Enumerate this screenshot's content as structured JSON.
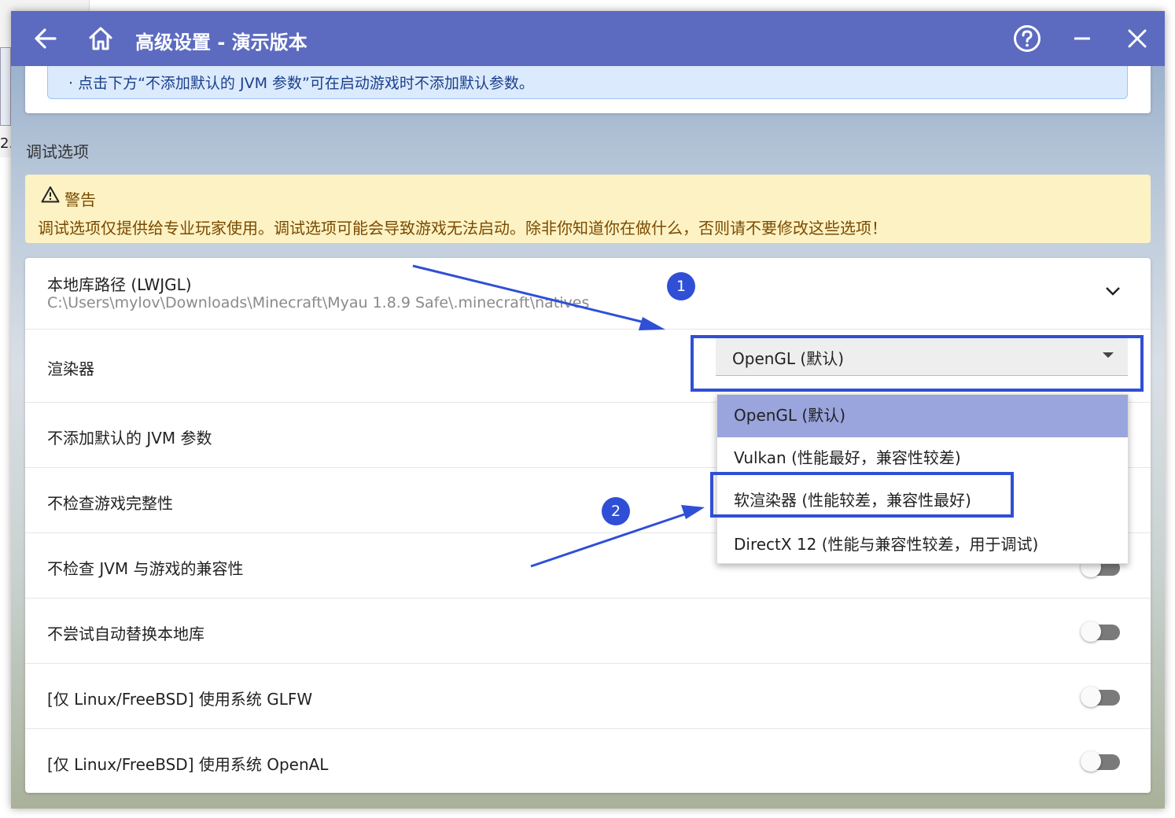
{
  "window": {
    "title": "高级设置 - 演示版本"
  },
  "background_window": {
    "fragment_text": "2."
  },
  "info_box": {
    "text": "· 点击下方“不添加默认的 JVM 参数”可在启动游戏时不添加默认参数。"
  },
  "debug_section": {
    "title": "调试选项",
    "warning_title": "警告",
    "warning_text": "调试选项仅提供给专业玩家使用。调试选项可能会导致游戏无法启动。除非你知道你在做什么，否则请不要修改这些选项！"
  },
  "settings": {
    "native_path": {
      "label": "本地库路径 (LWJGL)",
      "value": "C:\\Users\\mylov\\Downloads\\Minecraft\\Myau 1.8.9 Safe\\.minecraft\\natives"
    },
    "renderer": {
      "label": "渲染器",
      "selected": "OpenGL (默认)",
      "options": [
        "OpenGL (默认)",
        "Vulkan (性能最好，兼容性较差)",
        "软渲染器 (性能较差，兼容性最好)",
        "DirectX 12 (性能与兼容性较差，用于调试)"
      ]
    },
    "toggles": [
      {
        "label": "不添加默认的 JVM 参数",
        "on": false
      },
      {
        "label": "不检查游戏完整性",
        "on": false
      },
      {
        "label": "不检查 JVM 与游戏的兼容性",
        "on": false
      },
      {
        "label": "不尝试自动替换本地库",
        "on": false
      },
      {
        "label": "[仅 Linux/FreeBSD] 使用系统 GLFW",
        "on": false
      },
      {
        "label": "[仅 Linux/FreeBSD] 使用系统 OpenAL",
        "on": false
      }
    ]
  },
  "annotations": {
    "badge_1": "1",
    "badge_2": "2"
  },
  "colors": {
    "titlebar": "#5c6bc0",
    "highlight": "#2f4fd6",
    "dropdown_selected": "#9aa5dd",
    "warning_bg": "#fdf2c4",
    "info_bg": "#dbeafc"
  },
  "icons": {
    "back": "arrow-left-icon",
    "home": "home-icon",
    "help": "help-circle-icon",
    "minimize": "minimize-icon",
    "close": "close-icon",
    "warning": "warning-triangle-icon",
    "expand": "chevron-down-icon",
    "dropdown": "caret-down-icon"
  }
}
